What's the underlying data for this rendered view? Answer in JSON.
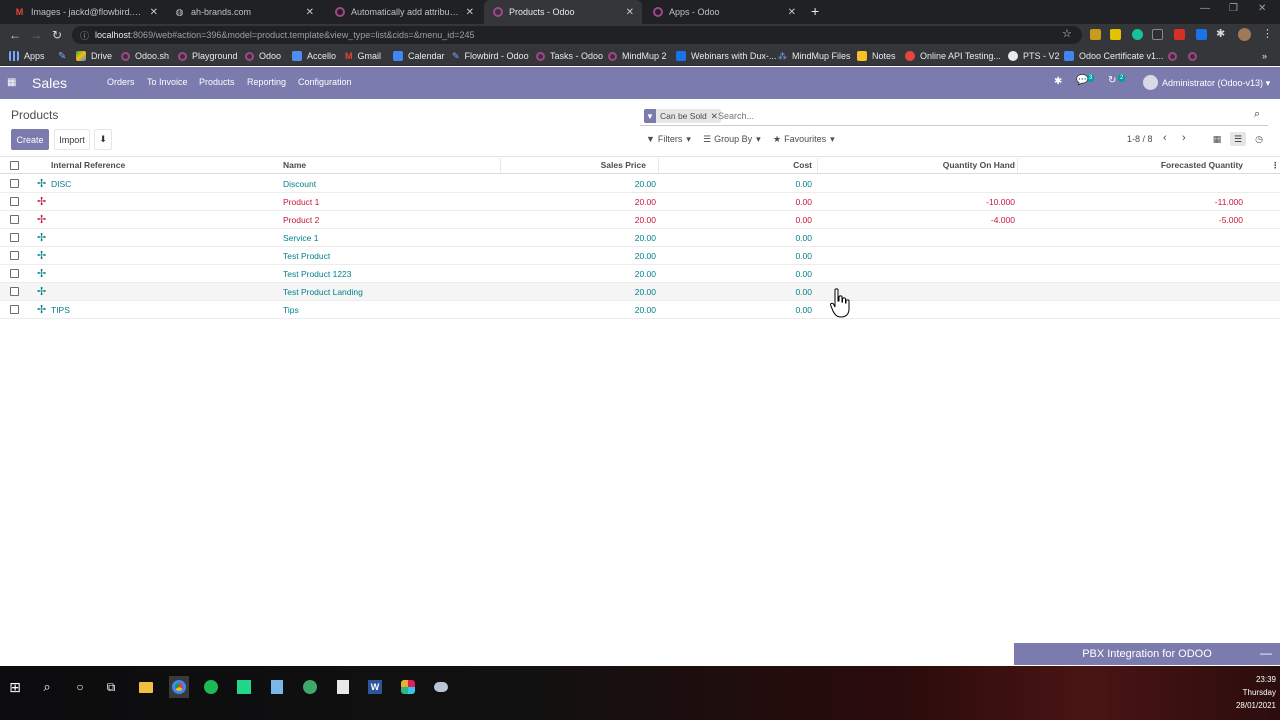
{
  "browser": {
    "tabs": [
      {
        "title": "Images - jackd@flowbird.co.uk -",
        "icon": "gmail-icon",
        "active": false
      },
      {
        "title": "ah-brands.com",
        "icon": "globe-icon",
        "active": false
      },
      {
        "title": "Automatically add attributes and",
        "icon": "odoo-icon",
        "active": false
      },
      {
        "title": "Products - Odoo",
        "icon": "odoo-icon",
        "active": true
      },
      {
        "title": "Apps - Odoo",
        "icon": "odoo-icon",
        "active": false
      }
    ],
    "new_tab_symbol": "+",
    "url_host": "localhost",
    "url_path": ":8069/web#action=396&model=product.template&view_type=list&cids=&menu_id=245",
    "bookmarks": [
      {
        "label": "Apps",
        "icon": "apps-grid-icon"
      },
      {
        "label": "",
        "icon": "pen-icon"
      },
      {
        "label": "Drive",
        "icon": "drive-icon"
      },
      {
        "label": "Odoo.sh",
        "icon": "odoo-icon"
      },
      {
        "label": "Playground",
        "icon": "odoo-icon"
      },
      {
        "label": "Odoo",
        "icon": "odoo-icon"
      },
      {
        "label": "Accello",
        "icon": "accello-icon"
      },
      {
        "label": "Gmail",
        "icon": "gmail-icon"
      },
      {
        "label": "Calendar",
        "icon": "calendar-icon"
      },
      {
        "label": "Flowbird - Odoo",
        "icon": "flowbird-icon"
      },
      {
        "label": "Tasks - Odoo",
        "icon": "odoo-icon"
      },
      {
        "label": "MindMup 2",
        "icon": "odoo-icon"
      },
      {
        "label": "Webinars with Dux-...",
        "icon": "webinar-icon"
      },
      {
        "label": "MindMup Files",
        "icon": "mindmup-icon"
      },
      {
        "label": "Notes",
        "icon": "notes-icon"
      },
      {
        "label": "Online API Testing...",
        "icon": "api-icon"
      },
      {
        "label": "PTS - V2",
        "icon": "github-icon"
      },
      {
        "label": "Odoo Certificate v1...",
        "icon": "doc-icon"
      }
    ]
  },
  "app": {
    "name": "Sales",
    "menus": [
      "Orders",
      "To Invoice",
      "Products",
      "Reporting",
      "Configuration"
    ],
    "messages_count": "3",
    "activities_count": "2",
    "user": "Administrator (Odoo-v13)"
  },
  "control_panel": {
    "breadcrumb": "Products",
    "create_label": "Create",
    "import_label": "Import",
    "facet_label": "Can be Sold",
    "search_placeholder": "Search...",
    "filters_label": "Filters",
    "groupby_label": "Group By",
    "favourites_label": "Favourites",
    "pager": "1-8 / 8"
  },
  "table": {
    "columns": [
      "Internal Reference",
      "Name",
      "Sales Price",
      "Cost",
      "Quantity On Hand",
      "Forecasted Quantity"
    ],
    "rows": [
      {
        "ref": "DISC",
        "name": "Discount",
        "price": "20.00",
        "cost": "0.00",
        "qty": "",
        "forecast": "",
        "negative": false
      },
      {
        "ref": "",
        "name": "Product 1",
        "price": "20.00",
        "cost": "0.00",
        "qty": "-10.000",
        "forecast": "-11.000",
        "negative": true
      },
      {
        "ref": "",
        "name": "Product 2",
        "price": "20.00",
        "cost": "0.00",
        "qty": "-4.000",
        "forecast": "-5.000",
        "negative": true
      },
      {
        "ref": "",
        "name": "Service 1",
        "price": "20.00",
        "cost": "0.00",
        "qty": "",
        "forecast": "",
        "negative": false
      },
      {
        "ref": "",
        "name": "Test Product",
        "price": "20.00",
        "cost": "0.00",
        "qty": "",
        "forecast": "",
        "negative": false
      },
      {
        "ref": "",
        "name": "Test Product 1223",
        "price": "20.00",
        "cost": "0.00",
        "qty": "",
        "forecast": "",
        "negative": false
      },
      {
        "ref": "",
        "name": "Test Product Landing",
        "price": "20.00",
        "cost": "0.00",
        "qty": "",
        "forecast": "",
        "negative": false
      },
      {
        "ref": "TIPS",
        "name": "Tips",
        "price": "20.00",
        "cost": "0.00",
        "qty": "",
        "forecast": "",
        "negative": false
      }
    ]
  },
  "widgets": {
    "pbx_label": "PBX Integration for ODOO"
  },
  "taskbar": {
    "time": "23:39",
    "day": "Thursday",
    "date": "28/01/2021"
  },
  "colors": {
    "odoo_purple": "#7c7bad",
    "teal": "#01808b",
    "negative_red": "#c9143a",
    "chrome_dark": "#202124"
  }
}
